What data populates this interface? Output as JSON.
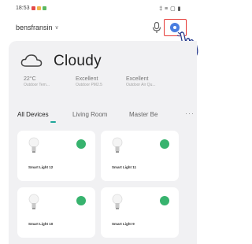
{
  "status_bar": {
    "time": "18:53",
    "right_icons": "‡ ≡ ▢ ▮",
    "dot_colors": [
      "#e34b4b",
      "#f1b54a",
      "#5bb860"
    ]
  },
  "header": {
    "home_name": "bensfransin",
    "chevron": "∨",
    "mic_icon": "microphone-icon",
    "add_icon": "add-device-icon",
    "highlight_color": "#e53935",
    "add_color": "#4a7ee0"
  },
  "weather": {
    "icon": "cloud-icon",
    "condition": "Cloudy",
    "stats": [
      {
        "value": "22°C",
        "label": "Outdoor Tem..."
      },
      {
        "value": "Excellent",
        "label": "Outdoor PM2.5"
      },
      {
        "value": "Excellent",
        "label": "Outdoor Air Qu..."
      }
    ]
  },
  "tabs": {
    "items": [
      "All Devices",
      "Living Room",
      "Master Be"
    ],
    "active_index": 0,
    "more": "···",
    "accent": "#1ea69a"
  },
  "devices": [
    {
      "name": "Smart Light 12",
      "icon": "light-bulb-icon",
      "power": "on"
    },
    {
      "name": "Smart Light 11",
      "icon": "light-bulb-icon",
      "power": "on"
    },
    {
      "name": "Smart Light 10",
      "icon": "light-bulb-icon",
      "power": "on"
    },
    {
      "name": "Smart Light 9",
      "icon": "light-bulb-icon",
      "power": "on"
    }
  ],
  "colors": {
    "power_on": "#37b36e",
    "panel_bg": "#f1f1f3"
  }
}
